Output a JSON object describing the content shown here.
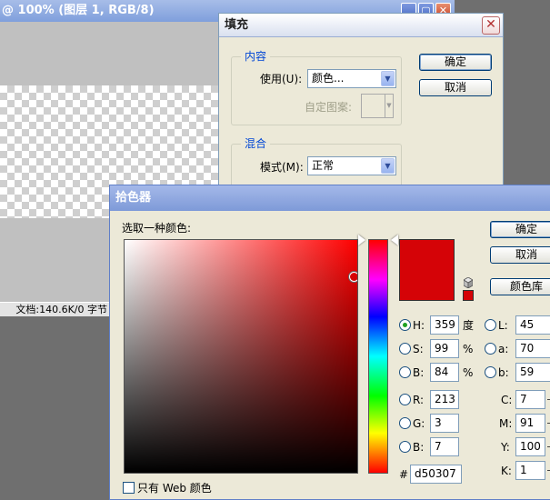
{
  "doc": {
    "title": "@ 100% (图层 1, RGB/8)",
    "minimize_glyph": "_",
    "maximize_glyph": "▢",
    "close_glyph": "✕",
    "status": "文档:140.6K/0 字节"
  },
  "fill": {
    "title": "填充",
    "close_glyph": "✕",
    "contents_legend": "内容",
    "use_label": "使用(U):",
    "use_value": "颜色...",
    "pattern_label": "自定图案:",
    "blend_legend": "混合",
    "mode_label": "模式(M):",
    "mode_value": "正常",
    "ok_label": "确定",
    "cancel_label": "取消"
  },
  "picker": {
    "title": "拾色器",
    "select_label": "选取一种颜色:",
    "ok_label": "确定",
    "cancel_label": "取消",
    "library_label": "颜色库",
    "web_only_label": "只有 Web 颜色",
    "current_color": "#d50307",
    "hue_field_color": "#ff0000",
    "hsb": {
      "h_label": "H:",
      "h_value": "359",
      "h_unit": "度",
      "s_label": "S:",
      "s_value": "99",
      "s_unit": "%",
      "b_label": "B:",
      "b_value": "84",
      "b_unit": "%"
    },
    "rgb": {
      "r_label": "R:",
      "r_value": "213",
      "g_label": "G:",
      "g_value": "3",
      "b_label": "B:",
      "b_value": "7"
    },
    "lab": {
      "l_label": "L:",
      "l_value": "45",
      "a_label": "a:",
      "a_value": "70",
      "b_label": "b:",
      "b_value": "59"
    },
    "cmyk": {
      "c_label": "C:",
      "c_value": "7",
      "m_label": "M:",
      "m_value": "91",
      "y_label": "Y:",
      "y_value": "100",
      "k_label": "K:",
      "k_value": "1"
    },
    "hex_label": "#",
    "hex_value": "d50307",
    "selected_radio": "H"
  }
}
